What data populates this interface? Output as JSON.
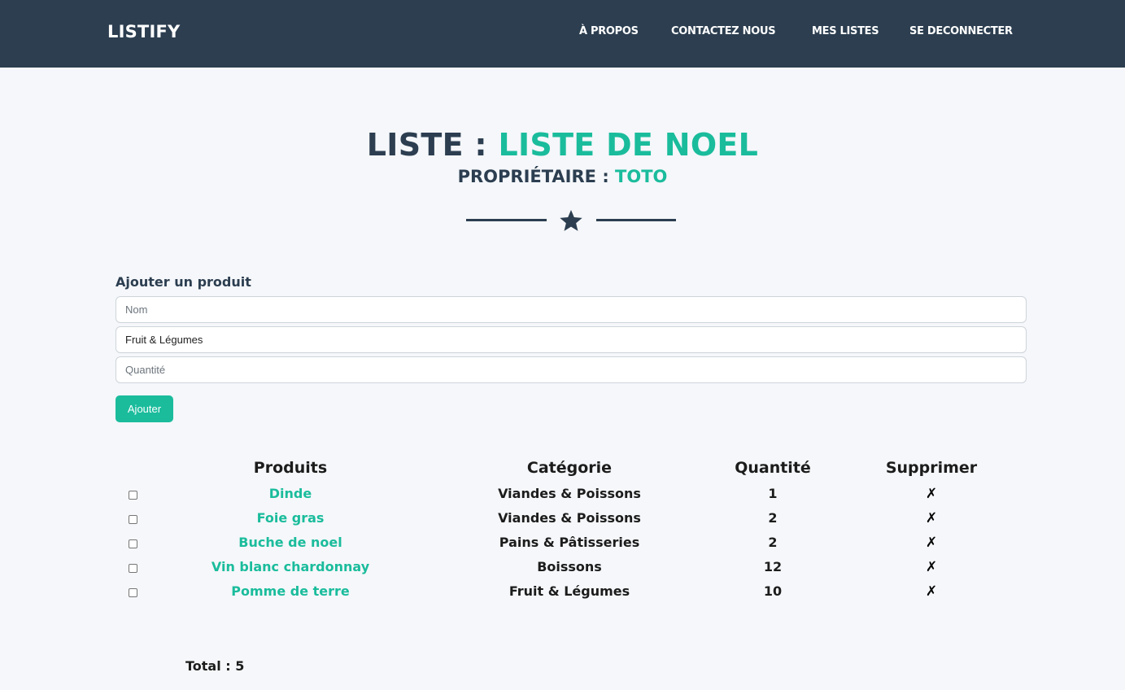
{
  "nav": {
    "brand": "LISTIFY",
    "links": [
      "À PROPOS",
      "CONTACTEZ NOUS",
      "MES LISTES",
      "SE DECONNECTER"
    ]
  },
  "header": {
    "title_prefix": "LISTE : ",
    "title_value": "LISTE DE NOEL",
    "owner_prefix": "PROPRIÉTAIRE : ",
    "owner_value": "TOTO",
    "divider_icon": "star-icon"
  },
  "form": {
    "title": "Ajouter un produit",
    "name_placeholder": "Nom",
    "category_value": "Fruit & Légumes",
    "quantity_placeholder": "Quantité",
    "submit_label": "Ajouter"
  },
  "table": {
    "headers": [
      "Produits",
      "Catégorie",
      "Quantité",
      "Supprimer"
    ],
    "rows": [
      {
        "product": "Dinde",
        "category": "Viandes & Poissons",
        "quantity": "1",
        "delete": "✗"
      },
      {
        "product": "Foie gras",
        "category": "Viandes & Poissons",
        "quantity": "2",
        "delete": "✗"
      },
      {
        "product": "Buche de noel",
        "category": "Pains & Pâtisseries",
        "quantity": "2",
        "delete": "✗"
      },
      {
        "product": "Vin blanc chardonnay",
        "category": "Boissons",
        "quantity": "12",
        "delete": "✗"
      },
      {
        "product": "Pomme de terre",
        "category": "Fruit & Légumes",
        "quantity": "10",
        "delete": "✗"
      }
    ]
  },
  "total": "Total : 5",
  "colors": {
    "navbar": "#2c3e50",
    "accent": "#1abc9c",
    "text": "#2c3e50",
    "background": "#f5f7fa"
  }
}
